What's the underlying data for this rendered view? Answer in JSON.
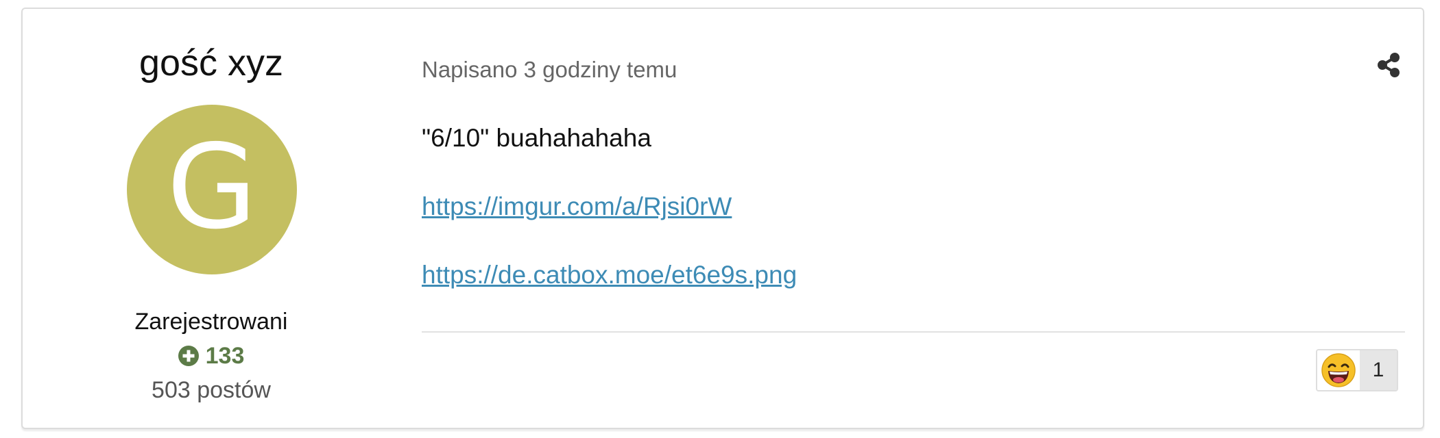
{
  "author": {
    "name": "gość xyz",
    "avatar_letter": "G",
    "avatar_color": "#c4bf61",
    "group": "Zarejestrowani",
    "reputation": "133",
    "reputation_icon": "plus-circle-icon",
    "post_count": "503 postów"
  },
  "post": {
    "meta": "Napisano 3 godziny temu",
    "share_icon": "share-icon",
    "text": "\"6/10\" buahahahaha",
    "links": [
      "https://imgur.com/a/Rjsi0rW",
      "https://de.catbox.moe/et6e9s.png"
    ]
  },
  "reactions": [
    {
      "icon": "laughing-face-emoji",
      "count": "1"
    }
  ],
  "colors": {
    "link": "#3d8bb5",
    "reputation": "#5c7b47"
  }
}
